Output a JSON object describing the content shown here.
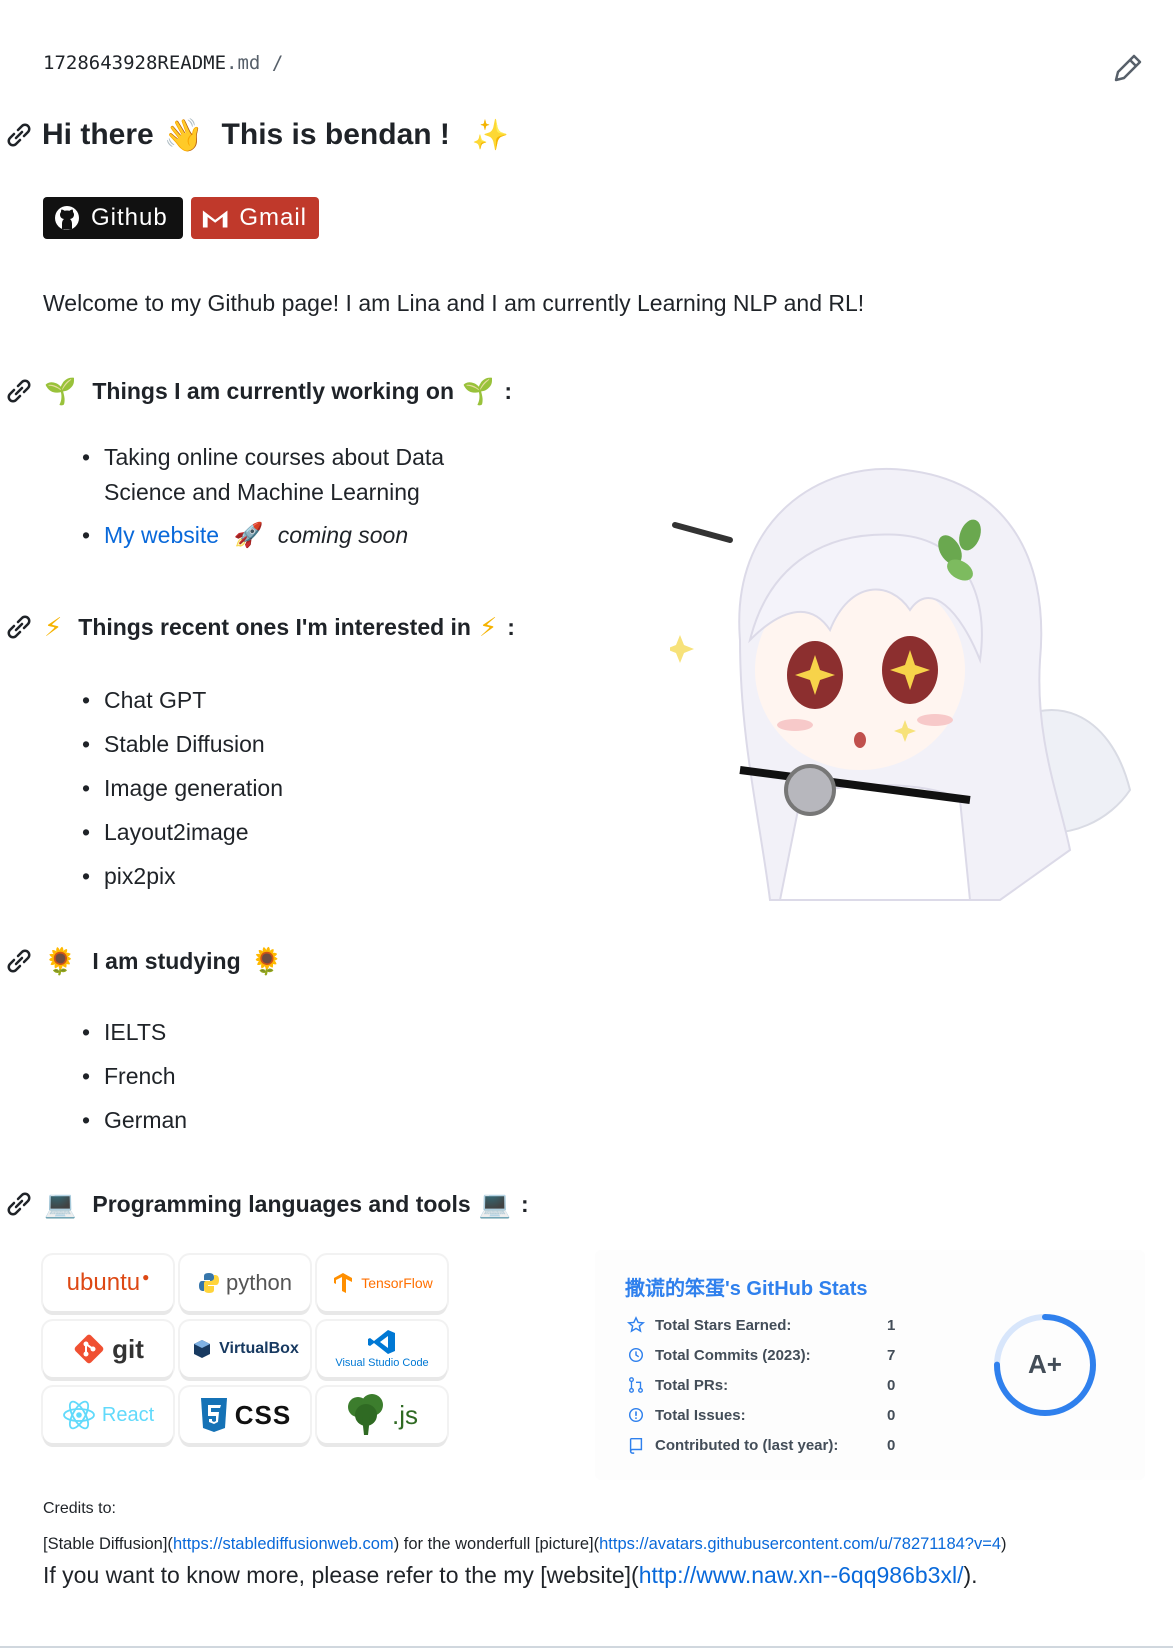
{
  "file": {
    "name": "1728643928README",
    "ext": ".md",
    "sep": "/"
  },
  "heading": {
    "hi": "Hi there",
    "name": "This is bendan !"
  },
  "badges": {
    "github": "Github",
    "gmail": "Gmail"
  },
  "welcome": "Welcome to my Github page! I am Lina and I am currently Learning NLP and RL!",
  "sections": {
    "working": {
      "title": "Things I am currently working on",
      "suffix": ":"
    },
    "interested": {
      "title": "Things recent ones I'm interested in",
      "suffix": ":"
    },
    "studying": {
      "title": "I am studying"
    },
    "tools": {
      "title": "Programming languages and tools",
      "suffix": ":"
    }
  },
  "working_items": {
    "course_line1": "Taking online courses about Data",
    "course_line2": "Science and Machine Learning",
    "website_link": "My website",
    "website_note": "coming soon"
  },
  "interests": [
    "Chat GPT",
    "Stable Diffusion",
    "Image generation",
    "Layout2image",
    "pix2pix"
  ],
  "studying": [
    "IELTS",
    "French",
    "German"
  ],
  "tools": {
    "ubuntu": "ubuntu",
    "python": "python",
    "tensorflow": "TensorFlow",
    "git": "git",
    "virtualbox": "VirtualBox",
    "vscode": "Visual Studio Code",
    "react": "React",
    "css": "CSS",
    "node": ".js"
  },
  "stats": {
    "title": "撒谎的笨蛋's GitHub Stats",
    "rows": [
      {
        "label": "Total Stars Earned:",
        "value": "1",
        "icon": "star-icon"
      },
      {
        "label": "Total Commits (2023):",
        "value": "7",
        "icon": "history-icon"
      },
      {
        "label": "Total PRs:",
        "value": "0",
        "icon": "pull-request-icon"
      },
      {
        "label": "Total Issues:",
        "value": "0",
        "icon": "issue-icon"
      },
      {
        "label": "Contributed to (last year):",
        "value": "0",
        "icon": "repo-icon"
      }
    ],
    "grade": "A+",
    "grade_progress": 0.75,
    "accent": "#2f80ed"
  },
  "credits": {
    "title": "Credits to:",
    "pre1": "[Stable Diffusion](",
    "link1": "https://stablediffusionweb.com",
    "mid1": ") for the wonderfull [picture](",
    "link2": "https://avatars.githubusercontent.com/u/78271184?v=4",
    "end1": ")"
  },
  "refer": {
    "pre": "If you want to know more, please refer to the my [website](",
    "link": "http://www.naw.xn--6qq986b3xl/",
    "end": ")."
  }
}
